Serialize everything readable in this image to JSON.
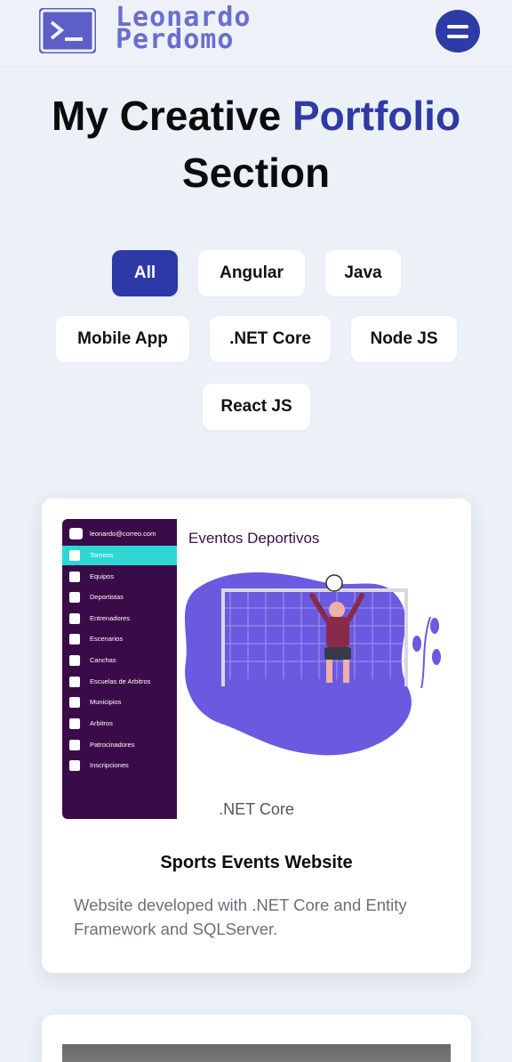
{
  "header": {
    "brand_line1": "Leonardo",
    "brand_line2": "Perdomo",
    "logo_icon": "terminal-icon",
    "menu_icon": "hamburger-icon"
  },
  "hero": {
    "title_part1": "My Creative ",
    "title_accent": "Portfolio",
    "title_part2": "Section"
  },
  "filters": [
    {
      "label": "All",
      "active": true
    },
    {
      "label": "Angular",
      "active": false
    },
    {
      "label": "Java",
      "active": false
    },
    {
      "label": "Mobile App",
      "active": false
    },
    {
      "label": ".NET Core",
      "active": false
    },
    {
      "label": "Node JS",
      "active": false
    },
    {
      "label": "React JS",
      "active": false
    }
  ],
  "project": {
    "screenshot": {
      "email": "leonardo@correo.com",
      "heading": "Eventos Deportivos",
      "menu": [
        "Torneos",
        "Equipos",
        "Deportistas",
        "Entrenadores",
        "Escenarios",
        "Canchas",
        "Escuelas de Arbitros",
        "Municipios",
        "Arbitros",
        "Patrocinadores",
        "Inscripciones"
      ]
    },
    "tech": ".NET Core",
    "title": "Sports Events Website",
    "description": "Website developed with .NET Core and Entity Framework and SQLServer."
  },
  "colors": {
    "accent": "#2e39a8",
    "brand": "#6a6ecf",
    "sidebar": "#3a0b49",
    "sidebar_selected": "#2fd6d4",
    "illustration": "#6a5ae0"
  }
}
